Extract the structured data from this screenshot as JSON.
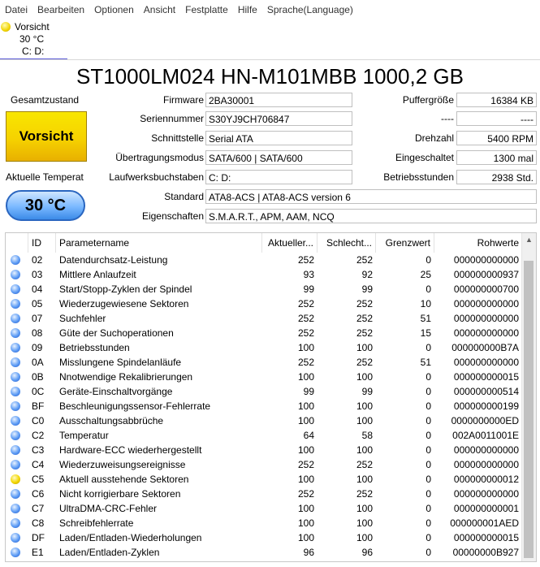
{
  "menu": [
    "Datei",
    "Bearbeiten",
    "Optionen",
    "Ansicht",
    "Festplatte",
    "Hilfe",
    "Sprache(Language)"
  ],
  "drive_tab": {
    "status": "Vorsicht",
    "temperature": "30 °C",
    "letters": "C: D:"
  },
  "model_title": "ST1000LM024 HN-M101MBB 1000,2 GB",
  "health": {
    "label": "Gesamtzustand",
    "status": "Vorsicht",
    "status_color": "#f6d200"
  },
  "temperature": {
    "label": "Aktuelle Temperat",
    "value": "30 °C",
    "color": "#7ab8ff"
  },
  "info": {
    "firmware_label": "Firmware",
    "firmware": "2BA30001",
    "serial_label": "Seriennummer",
    "serial": "S30YJ9CH706847",
    "interface_label": "Schnittstelle",
    "interface": "Serial ATA",
    "transfer_label": "Übertragungsmodus",
    "transfer": "SATA/600 | SATA/600",
    "letters_label": "Laufwerksbuchstaben",
    "letters": "C: D:",
    "standard_label": "Standard",
    "standard": "ATA8-ACS | ATA8-ACS version 6",
    "features_label": "Eigenschaften",
    "features": "S.M.A.R.T., APM, AAM, NCQ",
    "buffer_label": "Puffergröße",
    "buffer": "16384 KB",
    "blank1_label": "----",
    "blank1": "----",
    "rpm_label": "Drehzahl",
    "rpm": "5400 RPM",
    "power_count_label": "Eingeschaltet",
    "power_count": "1300 mal",
    "power_hours_label": "Betriebsstunden",
    "power_hours": "2938 Std."
  },
  "table": {
    "headers": [
      "ID",
      "Parametername",
      "Aktueller...",
      "Schlecht...",
      "Grenzwert",
      "Rohwerte"
    ],
    "rows": [
      {
        "status": "good",
        "id": "02",
        "name": "Datendurchsatz-Leistung",
        "current": "252",
        "worst": "252",
        "threshold": "0",
        "raw": "000000000000"
      },
      {
        "status": "good",
        "id": "03",
        "name": "Mittlere Anlaufzeit",
        "current": "93",
        "worst": "92",
        "threshold": "25",
        "raw": "000000000937"
      },
      {
        "status": "good",
        "id": "04",
        "name": "Start/Stopp-Zyklen der Spindel",
        "current": "99",
        "worst": "99",
        "threshold": "0",
        "raw": "000000000700"
      },
      {
        "status": "good",
        "id": "05",
        "name": "Wiederzugewiesene Sektoren",
        "current": "252",
        "worst": "252",
        "threshold": "10",
        "raw": "000000000000"
      },
      {
        "status": "good",
        "id": "07",
        "name": "Suchfehler",
        "current": "252",
        "worst": "252",
        "threshold": "51",
        "raw": "000000000000"
      },
      {
        "status": "good",
        "id": "08",
        "name": "Güte der Suchoperationen",
        "current": "252",
        "worst": "252",
        "threshold": "15",
        "raw": "000000000000"
      },
      {
        "status": "good",
        "id": "09",
        "name": "Betriebsstunden",
        "current": "100",
        "worst": "100",
        "threshold": "0",
        "raw": "000000000B7A"
      },
      {
        "status": "good",
        "id": "0A",
        "name": "Misslungene Spindelanläufe",
        "current": "252",
        "worst": "252",
        "threshold": "51",
        "raw": "000000000000"
      },
      {
        "status": "good",
        "id": "0B",
        "name": "Nnotwendige Rekalibrierungen",
        "current": "100",
        "worst": "100",
        "threshold": "0",
        "raw": "000000000015"
      },
      {
        "status": "good",
        "id": "0C",
        "name": "Geräte-Einschaltvorgänge",
        "current": "99",
        "worst": "99",
        "threshold": "0",
        "raw": "000000000514"
      },
      {
        "status": "good",
        "id": "BF",
        "name": "Beschleunigungssensor-Fehlerrate",
        "current": "100",
        "worst": "100",
        "threshold": "0",
        "raw": "000000000199"
      },
      {
        "status": "good",
        "id": "C0",
        "name": "Ausschaltungsabbrüche",
        "current": "100",
        "worst": "100",
        "threshold": "0",
        "raw": "0000000000ED"
      },
      {
        "status": "good",
        "id": "C2",
        "name": "Temperatur",
        "current": "64",
        "worst": "58",
        "threshold": "0",
        "raw": "002A0011001E"
      },
      {
        "status": "good",
        "id": "C3",
        "name": "Hardware-ECC wiederhergestellt",
        "current": "100",
        "worst": "100",
        "threshold": "0",
        "raw": "000000000000"
      },
      {
        "status": "good",
        "id": "C4",
        "name": "Wiederzuweisungsereignisse",
        "current": "252",
        "worst": "252",
        "threshold": "0",
        "raw": "000000000000"
      },
      {
        "status": "caution",
        "id": "C5",
        "name": "Aktuell ausstehende Sektoren",
        "current": "100",
        "worst": "100",
        "threshold": "0",
        "raw": "000000000012"
      },
      {
        "status": "good",
        "id": "C6",
        "name": "Nicht korrigierbare Sektoren",
        "current": "252",
        "worst": "252",
        "threshold": "0",
        "raw": "000000000000"
      },
      {
        "status": "good",
        "id": "C7",
        "name": "UltraDMA-CRC-Fehler",
        "current": "100",
        "worst": "100",
        "threshold": "0",
        "raw": "000000000001"
      },
      {
        "status": "good",
        "id": "C8",
        "name": "Schreibfehlerrate",
        "current": "100",
        "worst": "100",
        "threshold": "0",
        "raw": "000000001AED"
      },
      {
        "status": "good",
        "id": "DF",
        "name": "Laden/Entladen-Wiederholungen",
        "current": "100",
        "worst": "100",
        "threshold": "0",
        "raw": "000000000015"
      },
      {
        "status": "good",
        "id": "E1",
        "name": "Laden/Entladen-Zyklen",
        "current": "96",
        "worst": "96",
        "threshold": "0",
        "raw": "00000000B927"
      }
    ]
  }
}
